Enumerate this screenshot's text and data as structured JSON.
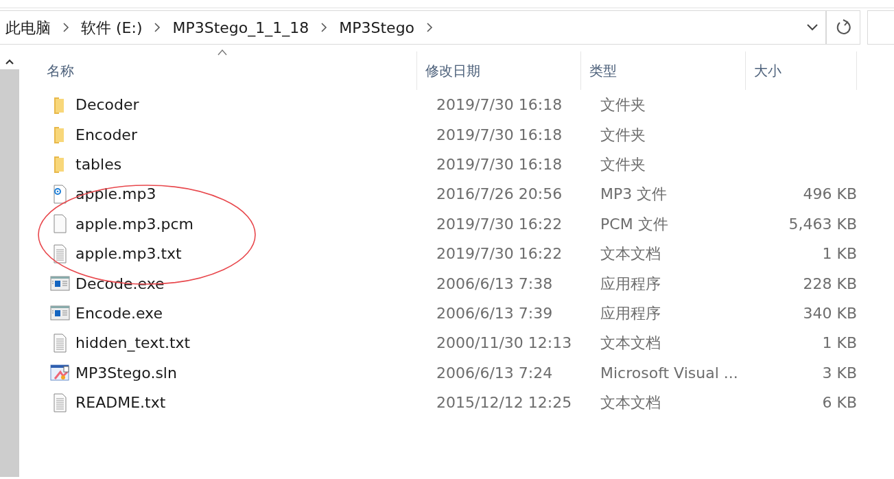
{
  "breadcrumb": [
    "此电脑",
    "软件 (E:)",
    "MP3Stego_1_1_18",
    "MP3Stego"
  ],
  "columns": [
    {
      "label": "名称",
      "sorted": true
    },
    {
      "label": "修改日期",
      "sorted": false
    },
    {
      "label": "类型",
      "sorted": false
    },
    {
      "label": "大小",
      "sorted": false
    }
  ],
  "files": [
    {
      "kind": "folder",
      "name": "Decoder",
      "modified": "2019/7/30 16:18",
      "type": "文件夹"
    },
    {
      "kind": "folder",
      "name": "Encoder",
      "modified": "2019/7/30 16:18",
      "type": "文件夹"
    },
    {
      "kind": "folder",
      "name": "tables",
      "modified": "2019/7/30 16:18",
      "type": "文件夹"
    },
    {
      "kind": "audio",
      "name": "apple.mp3",
      "modified": "2016/7/26 20:56",
      "type": "MP3 文件",
      "size": "496 KB"
    },
    {
      "kind": "blank",
      "name": "apple.mp3.pcm",
      "modified": "2019/7/30 16:22",
      "type": "PCM 文件",
      "size": "5,463 KB"
    },
    {
      "kind": "text",
      "name": "apple.mp3.txt",
      "modified": "2019/7/30 16:22",
      "type": "文本文档",
      "size": "1 KB"
    },
    {
      "kind": "exe",
      "name": "Decode.exe",
      "modified": "2006/6/13 7:38",
      "type": "应用程序",
      "size": "228 KB"
    },
    {
      "kind": "exe",
      "name": "Encode.exe",
      "modified": "2006/6/13 7:39",
      "type": "应用程序",
      "size": "340 KB"
    },
    {
      "kind": "text",
      "name": "hidden_text.txt",
      "modified": "2000/11/30 12:13",
      "type": "文本文档",
      "size": "1 KB"
    },
    {
      "kind": "solution",
      "name": "MP3Stego.sln",
      "modified": "2006/6/13 7:24",
      "type": "Microsoft Visual ...",
      "size": "3 KB"
    },
    {
      "kind": "text",
      "name": "README.txt",
      "modified": "2015/12/12 12:25",
      "type": "文本文档",
      "size": "6 KB"
    }
  ],
  "annotation": {
    "kind": "ellipse",
    "color": "#e8474c"
  }
}
